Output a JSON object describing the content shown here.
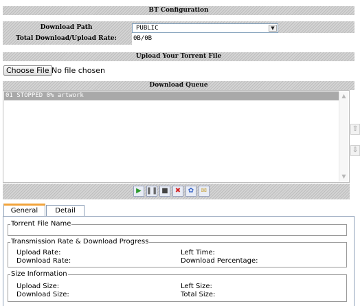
{
  "sections": {
    "bt_config": "BT Configuration",
    "upload_torrent": "Upload Your Torrent File",
    "download_queue": "Download Queue"
  },
  "config": {
    "download_path_label": "Download Path",
    "download_path_value": "PUBLIC",
    "rate_label": "Total Download/Upload Rate:",
    "rate_value": "0B/0B"
  },
  "upload": {
    "choose_button": "Choose File",
    "file_status": "No file chosen"
  },
  "queue": {
    "items": [
      {
        "text": "01  STOPPED  0%  artwork"
      }
    ]
  },
  "toolbar": {
    "buttons": [
      {
        "name": "start-icon",
        "color": "#2e9a2e",
        "glyph": "▶"
      },
      {
        "name": "pause-icon",
        "color": "#6a6a6a",
        "glyph": "❚❚"
      },
      {
        "name": "stop-icon",
        "color": "#444444",
        "glyph": "■"
      },
      {
        "name": "delete-icon",
        "color": "#d42424",
        "glyph": "✖"
      },
      {
        "name": "settings-icon",
        "color": "#3a66c8",
        "glyph": "✿"
      },
      {
        "name": "mail-icon",
        "color": "#c8a23a",
        "glyph": "✉"
      }
    ]
  },
  "side_buttons": {
    "up": "⇧",
    "down": "⇩"
  },
  "tabs": [
    {
      "label": "General",
      "active": true
    },
    {
      "label": "Detail",
      "active": false
    }
  ],
  "general": {
    "torrent_file_name": "Torrent File Name",
    "transmission": {
      "title": "Transmission Rate & Download Progress",
      "upload_rate": "Upload Rate:",
      "left_time": "Left Time:",
      "download_rate": "Download Rate:",
      "download_percentage": "Download Percentage:"
    },
    "size_info": {
      "title": "Size Information",
      "upload_size": "Upload Size:",
      "left_size": "Left Size:",
      "download_size": "Download Size:",
      "total_size": "Total Size:"
    }
  }
}
